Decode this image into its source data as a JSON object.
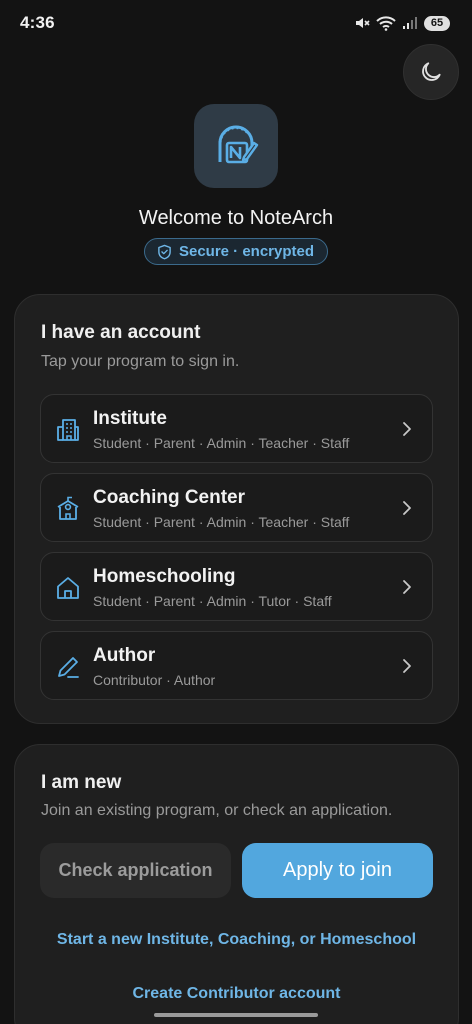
{
  "status_bar": {
    "time": "4:36",
    "battery": "65"
  },
  "header": {
    "title": "Welcome to NoteArch",
    "secure_badge": "Secure · encrypted"
  },
  "account_section": {
    "title": "I have an account",
    "subtitle": "Tap your program to sign in.",
    "programs": [
      {
        "name": "Institute",
        "roles": "Student · Parent · Admin · Teacher · Staff",
        "icon": "building-icon"
      },
      {
        "name": "Coaching Center",
        "roles": "Student · Parent · Admin · Teacher · Staff",
        "icon": "school-icon"
      },
      {
        "name": "Homeschooling",
        "roles": "Student · Parent · Admin · Tutor · Staff",
        "icon": "home-icon"
      },
      {
        "name": "Author",
        "roles": "Contributor · Author",
        "icon": "pen-icon"
      }
    ]
  },
  "new_section": {
    "title": "I am new",
    "subtitle": "Join an existing program, or check an application.",
    "check_application_label": "Check application",
    "apply_label": "Apply to join",
    "start_program_link": "Start a new Institute, Coaching, or Homeschool",
    "contributor_link": "Create Contributor account"
  },
  "colors": {
    "background": "#131313",
    "card": "#1f1f1f",
    "accent": "#52a7de",
    "accent_text": "#6fb6e6"
  }
}
